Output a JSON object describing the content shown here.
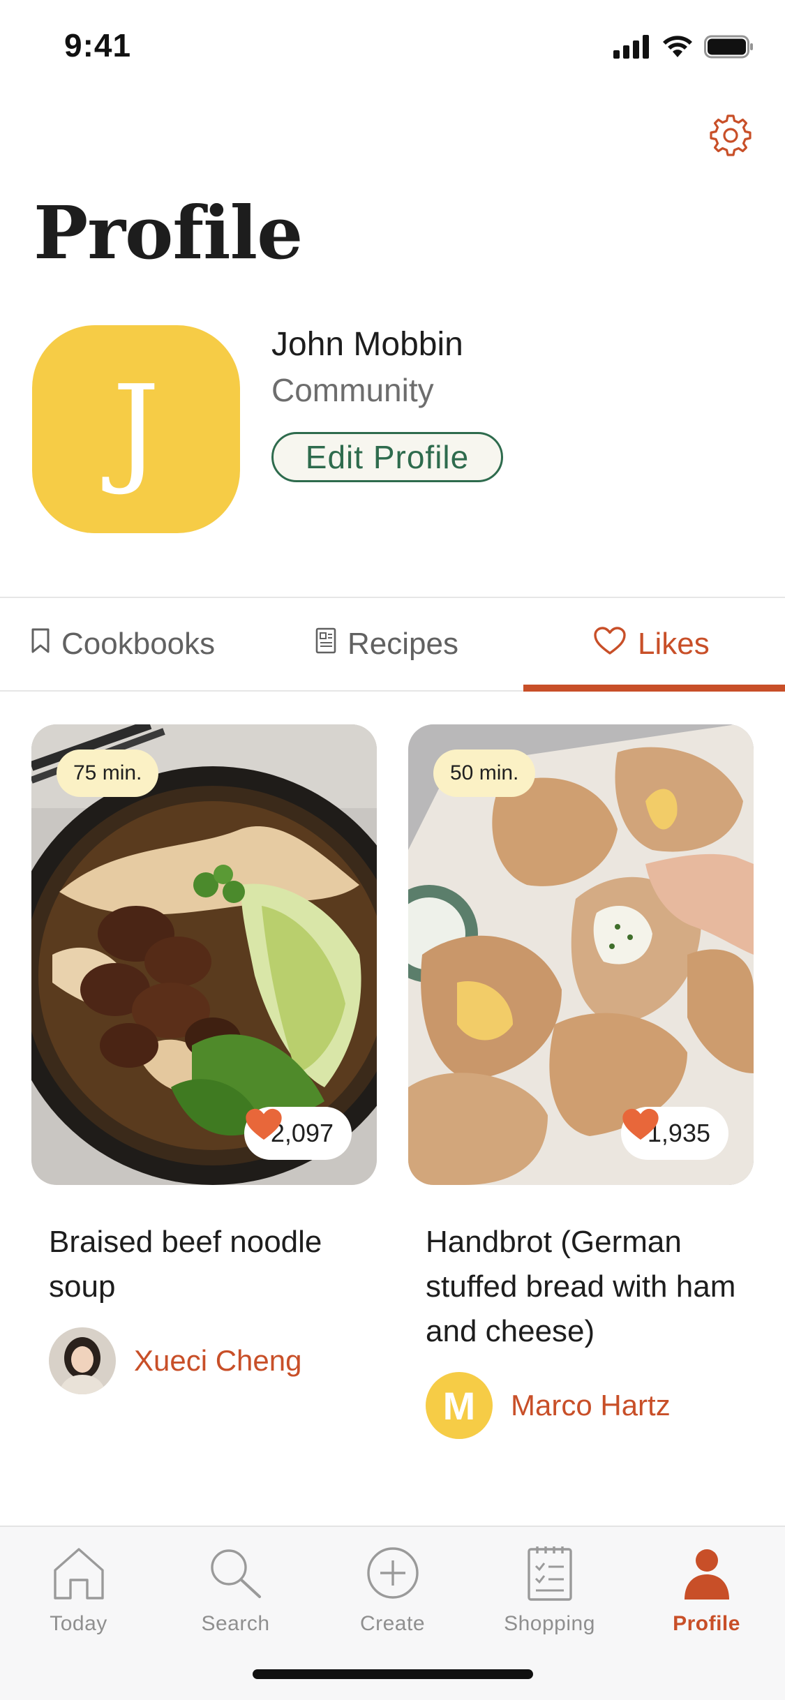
{
  "status_bar": {
    "time": "9:41"
  },
  "header": {
    "title": "Profile"
  },
  "profile": {
    "initial": "J",
    "name": "John Mobbin",
    "role": "Community",
    "edit_label": "Edit Profile",
    "avatar_color": "#F6CC46"
  },
  "tabs": [
    {
      "label": "Cookbooks",
      "icon": "bookmark-icon",
      "active": false
    },
    {
      "label": "Recipes",
      "icon": "recipe-card-icon",
      "active": false
    },
    {
      "label": "Likes",
      "icon": "heart-icon",
      "active": true
    }
  ],
  "recipes": [
    {
      "time": "75 min.",
      "likes": "2,097",
      "title": "Braised beef noodle soup",
      "author": "Xueci Cheng",
      "image": "braised-beef-noodle-soup-photo"
    },
    {
      "time": "50 min.",
      "likes": "1,935",
      "title": "Handbrot (German stuffed bread with ham and cheese)",
      "author": "Marco Hartz",
      "author_initial": "M",
      "image": "handbrot-bread-photo"
    }
  ],
  "bottom_nav": [
    {
      "label": "Today",
      "icon": "home-icon",
      "active": false
    },
    {
      "label": "Search",
      "icon": "search-icon",
      "active": false
    },
    {
      "label": "Create",
      "icon": "plus-circle-icon",
      "active": false
    },
    {
      "label": "Shopping",
      "icon": "checklist-icon",
      "active": false
    },
    {
      "label": "Profile",
      "icon": "person-icon",
      "active": true
    }
  ],
  "colors": {
    "accent": "#C84F28",
    "green": "#2E6B4D",
    "badge": "#FBF1C5",
    "heart": "#E8673A"
  }
}
